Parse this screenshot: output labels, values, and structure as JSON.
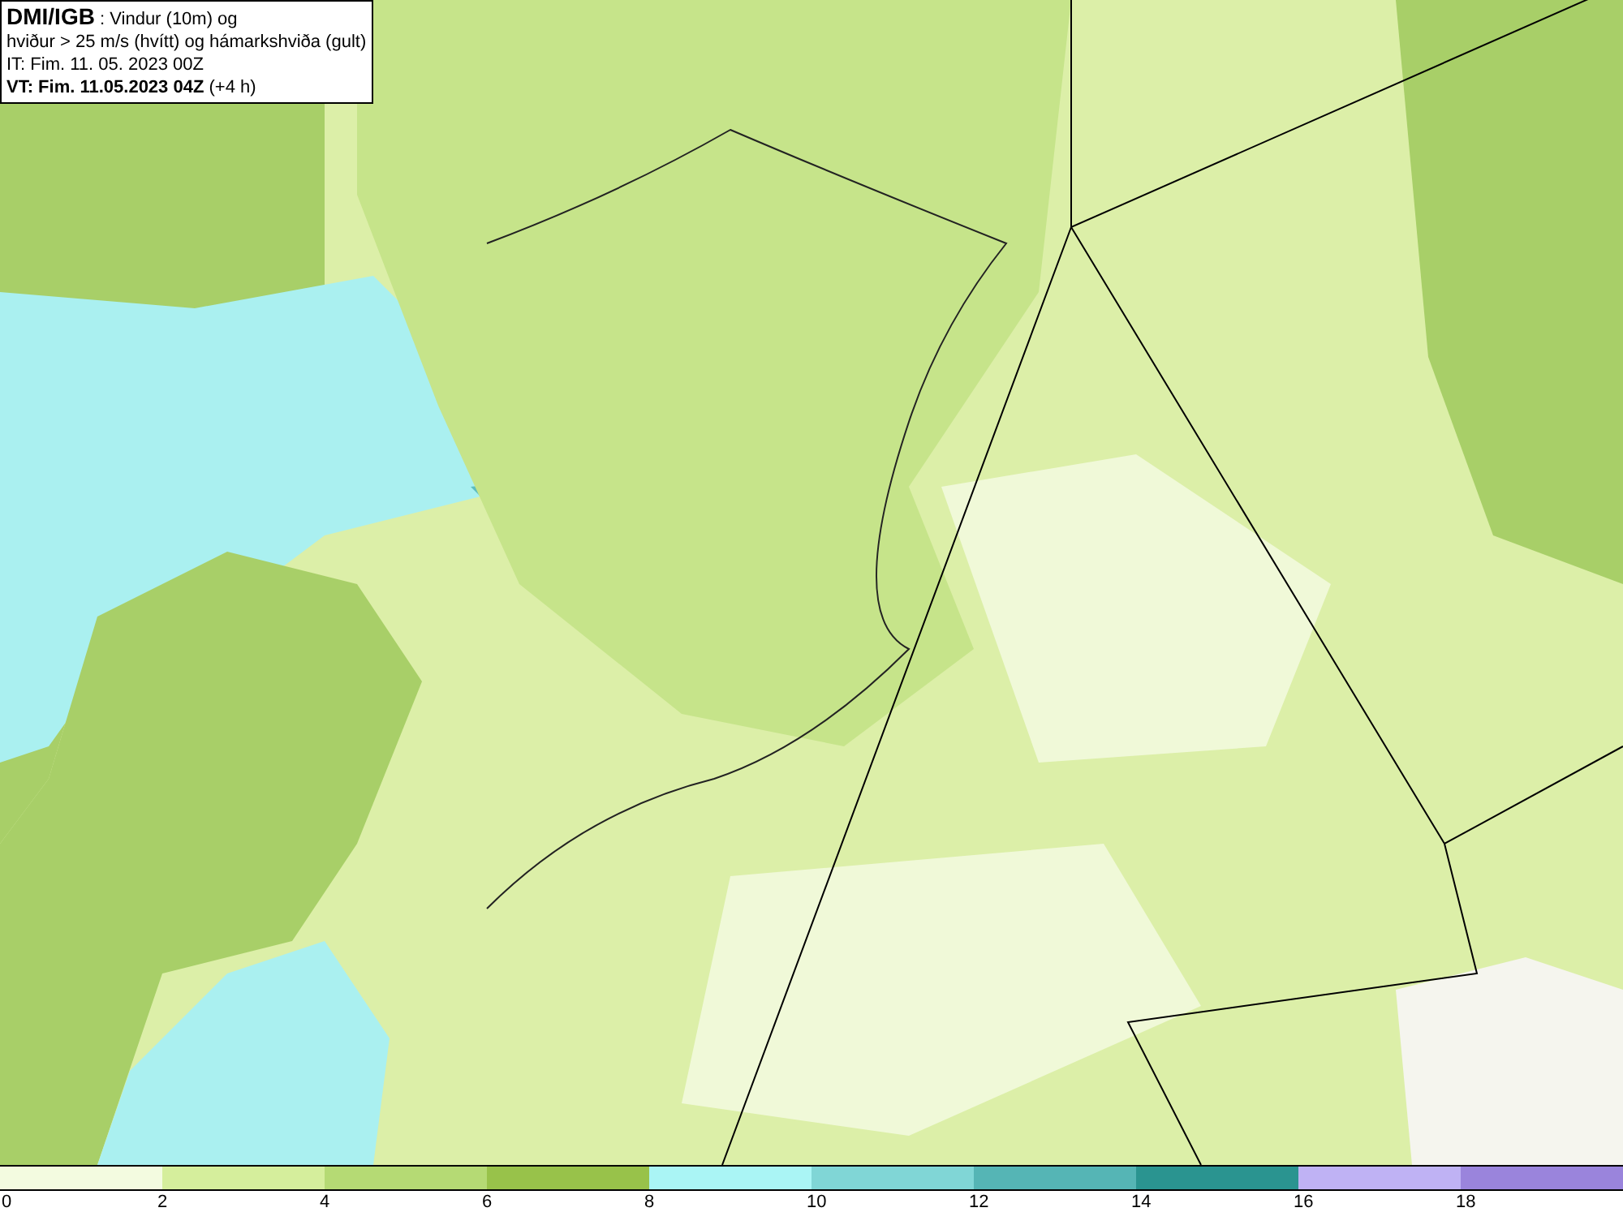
{
  "info_box": {
    "lines": [
      "**DMI/IGB** : Vindur (10m) og",
      "hviður > 25 m/s (hvítt) og hámarkshviða (gult)",
      "IT: Fim. 11. 05. 2023 00Z",
      "**VT: Fim. 11.05.2023 04Z** (+4 h)"
    ]
  },
  "legend": {
    "bins": [
      {
        "color": "#f3fbe0"
      },
      {
        "color": "#d5ee9c"
      },
      {
        "color": "#b5da74"
      },
      {
        "color": "#98c24a"
      },
      {
        "color": "#aaf5f5"
      },
      {
        "color": "#80d6d6"
      },
      {
        "color": "#55b5b5"
      },
      {
        "color": "#2a9490"
      },
      {
        "color": "#bfb2f4"
      },
      {
        "color": "#9a84dc"
      }
    ],
    "ticks": [
      "0",
      "2",
      "4",
      "6",
      "8",
      "10",
      "12",
      "14",
      "16",
      "18"
    ]
  }
}
